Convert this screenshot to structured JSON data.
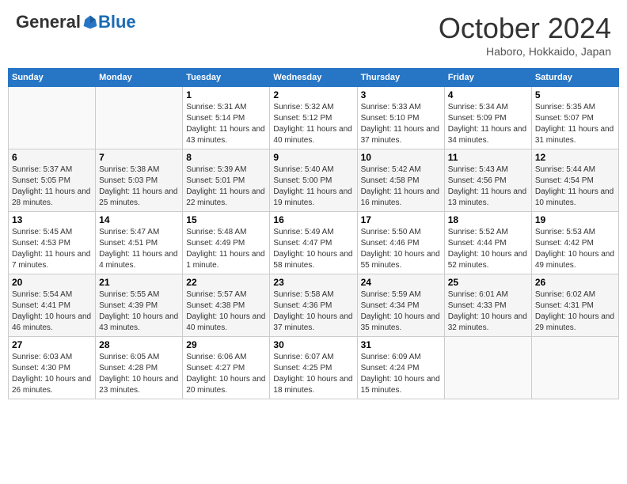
{
  "header": {
    "logo_general": "General",
    "logo_blue": "Blue",
    "month_title": "October 2024",
    "location": "Haboro, Hokkaido, Japan"
  },
  "days_of_week": [
    "Sunday",
    "Monday",
    "Tuesday",
    "Wednesday",
    "Thursday",
    "Friday",
    "Saturday"
  ],
  "weeks": [
    [
      {
        "day": "",
        "info": ""
      },
      {
        "day": "",
        "info": ""
      },
      {
        "day": "1",
        "sunrise": "5:31 AM",
        "sunset": "5:14 PM",
        "daylight": "11 hours and 43 minutes."
      },
      {
        "day": "2",
        "sunrise": "5:32 AM",
        "sunset": "5:12 PM",
        "daylight": "11 hours and 40 minutes."
      },
      {
        "day": "3",
        "sunrise": "5:33 AM",
        "sunset": "5:10 PM",
        "daylight": "11 hours and 37 minutes."
      },
      {
        "day": "4",
        "sunrise": "5:34 AM",
        "sunset": "5:09 PM",
        "daylight": "11 hours and 34 minutes."
      },
      {
        "day": "5",
        "sunrise": "5:35 AM",
        "sunset": "5:07 PM",
        "daylight": "11 hours and 31 minutes."
      }
    ],
    [
      {
        "day": "6",
        "sunrise": "5:37 AM",
        "sunset": "5:05 PM",
        "daylight": "11 hours and 28 minutes."
      },
      {
        "day": "7",
        "sunrise": "5:38 AM",
        "sunset": "5:03 PM",
        "daylight": "11 hours and 25 minutes."
      },
      {
        "day": "8",
        "sunrise": "5:39 AM",
        "sunset": "5:01 PM",
        "daylight": "11 hours and 22 minutes."
      },
      {
        "day": "9",
        "sunrise": "5:40 AM",
        "sunset": "5:00 PM",
        "daylight": "11 hours and 19 minutes."
      },
      {
        "day": "10",
        "sunrise": "5:42 AM",
        "sunset": "4:58 PM",
        "daylight": "11 hours and 16 minutes."
      },
      {
        "day": "11",
        "sunrise": "5:43 AM",
        "sunset": "4:56 PM",
        "daylight": "11 hours and 13 minutes."
      },
      {
        "day": "12",
        "sunrise": "5:44 AM",
        "sunset": "4:54 PM",
        "daylight": "11 hours and 10 minutes."
      }
    ],
    [
      {
        "day": "13",
        "sunrise": "5:45 AM",
        "sunset": "4:53 PM",
        "daylight": "11 hours and 7 minutes."
      },
      {
        "day": "14",
        "sunrise": "5:47 AM",
        "sunset": "4:51 PM",
        "daylight": "11 hours and 4 minutes."
      },
      {
        "day": "15",
        "sunrise": "5:48 AM",
        "sunset": "4:49 PM",
        "daylight": "11 hours and 1 minute."
      },
      {
        "day": "16",
        "sunrise": "5:49 AM",
        "sunset": "4:47 PM",
        "daylight": "10 hours and 58 minutes."
      },
      {
        "day": "17",
        "sunrise": "5:50 AM",
        "sunset": "4:46 PM",
        "daylight": "10 hours and 55 minutes."
      },
      {
        "day": "18",
        "sunrise": "5:52 AM",
        "sunset": "4:44 PM",
        "daylight": "10 hours and 52 minutes."
      },
      {
        "day": "19",
        "sunrise": "5:53 AM",
        "sunset": "4:42 PM",
        "daylight": "10 hours and 49 minutes."
      }
    ],
    [
      {
        "day": "20",
        "sunrise": "5:54 AM",
        "sunset": "4:41 PM",
        "daylight": "10 hours and 46 minutes."
      },
      {
        "day": "21",
        "sunrise": "5:55 AM",
        "sunset": "4:39 PM",
        "daylight": "10 hours and 43 minutes."
      },
      {
        "day": "22",
        "sunrise": "5:57 AM",
        "sunset": "4:38 PM",
        "daylight": "10 hours and 40 minutes."
      },
      {
        "day": "23",
        "sunrise": "5:58 AM",
        "sunset": "4:36 PM",
        "daylight": "10 hours and 37 minutes."
      },
      {
        "day": "24",
        "sunrise": "5:59 AM",
        "sunset": "4:34 PM",
        "daylight": "10 hours and 35 minutes."
      },
      {
        "day": "25",
        "sunrise": "6:01 AM",
        "sunset": "4:33 PM",
        "daylight": "10 hours and 32 minutes."
      },
      {
        "day": "26",
        "sunrise": "6:02 AM",
        "sunset": "4:31 PM",
        "daylight": "10 hours and 29 minutes."
      }
    ],
    [
      {
        "day": "27",
        "sunrise": "6:03 AM",
        "sunset": "4:30 PM",
        "daylight": "10 hours and 26 minutes."
      },
      {
        "day": "28",
        "sunrise": "6:05 AM",
        "sunset": "4:28 PM",
        "daylight": "10 hours and 23 minutes."
      },
      {
        "day": "29",
        "sunrise": "6:06 AM",
        "sunset": "4:27 PM",
        "daylight": "10 hours and 20 minutes."
      },
      {
        "day": "30",
        "sunrise": "6:07 AM",
        "sunset": "4:25 PM",
        "daylight": "10 hours and 18 minutes."
      },
      {
        "day": "31",
        "sunrise": "6:09 AM",
        "sunset": "4:24 PM",
        "daylight": "10 hours and 15 minutes."
      },
      {
        "day": "",
        "info": ""
      },
      {
        "day": "",
        "info": ""
      }
    ]
  ],
  "labels": {
    "sunrise": "Sunrise:",
    "sunset": "Sunset:",
    "daylight": "Daylight:"
  }
}
